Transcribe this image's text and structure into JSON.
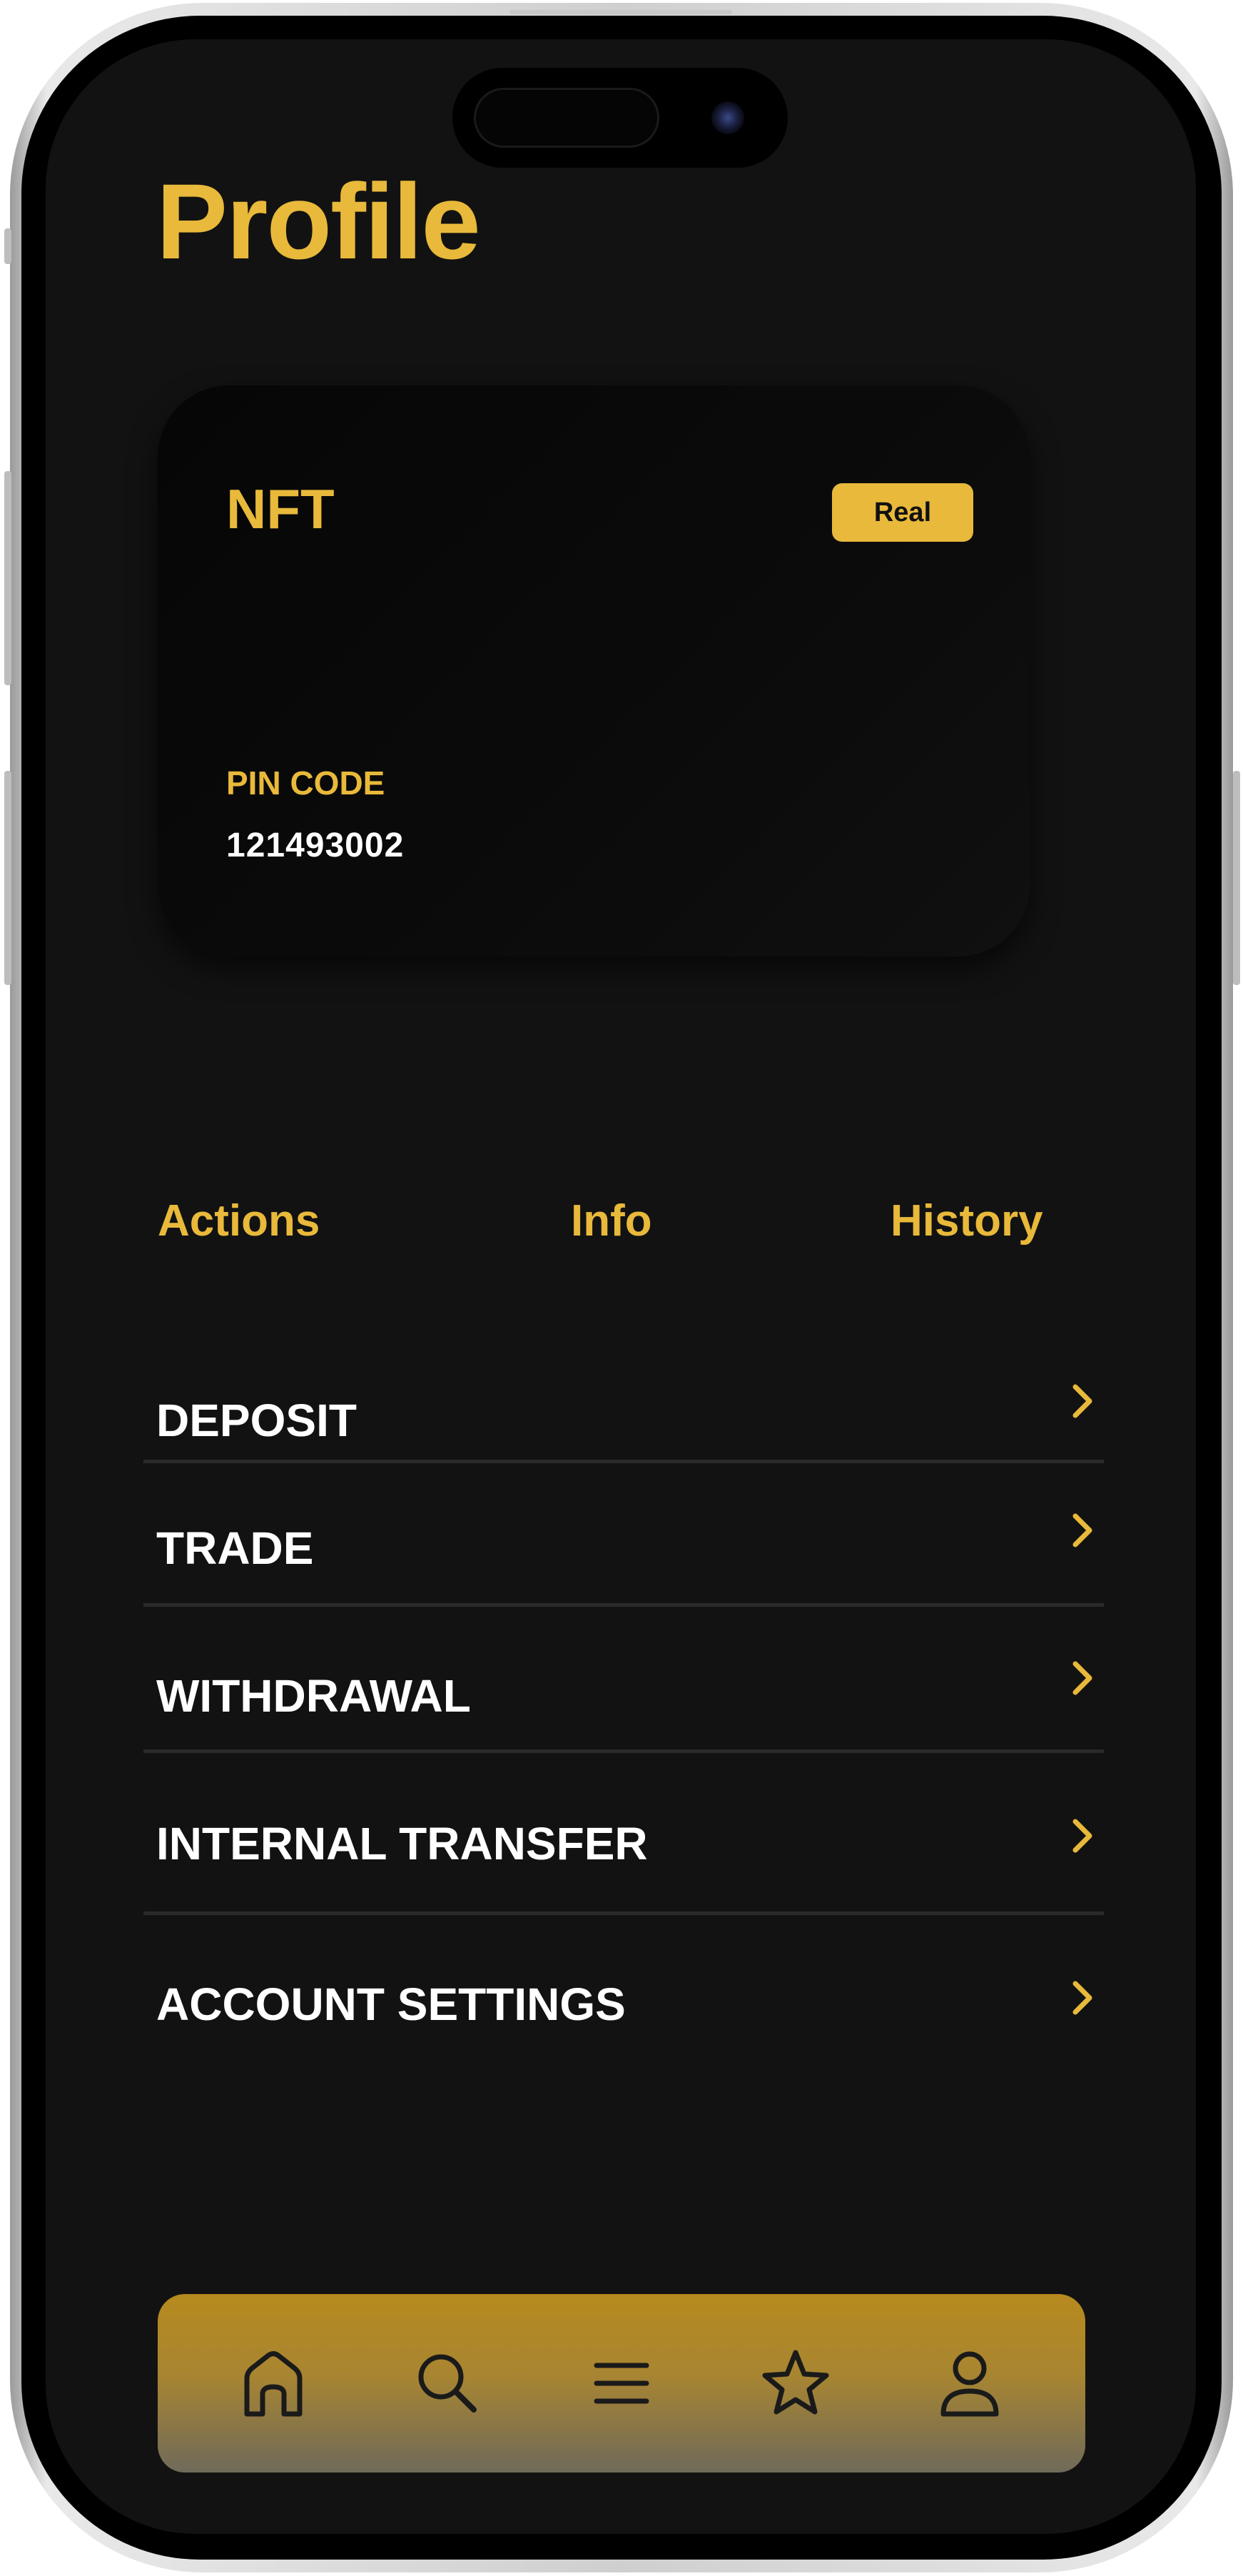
{
  "page": {
    "title": "Profile"
  },
  "card": {
    "brand": "NFT",
    "badge": "Real",
    "pin_label": "PIN CODE",
    "pin_value": "121493002"
  },
  "tabs": [
    {
      "label": "Actions"
    },
    {
      "label": "Info"
    },
    {
      "label": "History"
    }
  ],
  "menu": [
    {
      "label": "DEPOSIT",
      "icon": "chevron-right-icon"
    },
    {
      "label": "TRADE",
      "icon": "chevron-right-icon"
    },
    {
      "label": "WITHDRAWAL",
      "icon": "chevron-right-icon"
    },
    {
      "label": "INTERNAL TRANSFER",
      "icon": "chevron-right-icon"
    },
    {
      "label": "ACCOUNT SETTINGS",
      "icon": "chevron-right-icon"
    }
  ],
  "bottom_nav": [
    {
      "icon": "home-icon"
    },
    {
      "icon": "search-icon"
    },
    {
      "icon": "menu-icon"
    },
    {
      "icon": "star-icon"
    },
    {
      "icon": "user-icon"
    }
  ],
  "colors": {
    "accent": "#e8b93a",
    "background": "#121212",
    "text": "#ffffff"
  }
}
